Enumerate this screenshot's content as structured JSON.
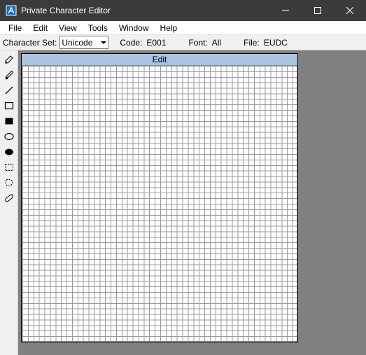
{
  "titlebar": {
    "title": "Private Character Editor"
  },
  "menubar": {
    "items": [
      "File",
      "Edit",
      "View",
      "Tools",
      "Window",
      "Help"
    ]
  },
  "infobar": {
    "charset_label": "Character Set:",
    "charset_value": "Unicode",
    "code_label": "Code:",
    "code_value": "E001",
    "font_label": "Font:",
    "font_value": "All",
    "file_label": "File:",
    "file_value": "EUDC"
  },
  "canvas": {
    "header": "Edit"
  },
  "tools": [
    {
      "name": "pencil-tool-icon"
    },
    {
      "name": "brush-tool-icon"
    },
    {
      "name": "line-tool-icon"
    },
    {
      "name": "rect-outline-tool-icon"
    },
    {
      "name": "rect-fill-tool-icon"
    },
    {
      "name": "ellipse-outline-tool-icon"
    },
    {
      "name": "ellipse-fill-tool-icon"
    },
    {
      "name": "rect-select-tool-icon"
    },
    {
      "name": "freeform-select-tool-icon"
    },
    {
      "name": "eraser-tool-icon"
    }
  ]
}
